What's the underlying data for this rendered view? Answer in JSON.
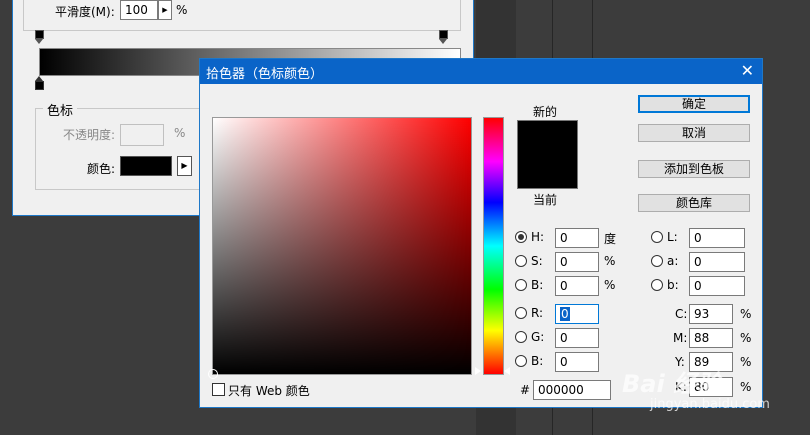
{
  "background_dialog": {
    "smoothness_label": "平滑度(M):",
    "smoothness_value": "100",
    "smoothness_unit": "%",
    "group_title": "色标",
    "opacity_label": "不透明度:",
    "opacity_unit": "%",
    "color_label": "颜色:"
  },
  "picker": {
    "title": "拾色器（色标颜色）",
    "new_label": "新的",
    "current_label": "当前",
    "buttons": {
      "ok": "确定",
      "cancel": "取消",
      "add_swatch": "添加到色板",
      "libraries": "颜色库"
    },
    "hsb": [
      {
        "label": "H:",
        "value": "0",
        "unit": "度",
        "selected": true
      },
      {
        "label": "S:",
        "value": "0",
        "unit": "%"
      },
      {
        "label": "B:",
        "value": "0",
        "unit": "%"
      }
    ],
    "rgb": [
      {
        "label": "R:",
        "value": "0"
      },
      {
        "label": "G:",
        "value": "0"
      },
      {
        "label": "B:",
        "value": "0"
      }
    ],
    "lab": [
      {
        "label": "L:",
        "value": "0"
      },
      {
        "label": "a:",
        "value": "0"
      },
      {
        "label": "b:",
        "value": "0"
      }
    ],
    "cmyk": [
      {
        "label": "C:",
        "value": "93",
        "unit": "%"
      },
      {
        "label": "M:",
        "value": "88",
        "unit": "%"
      },
      {
        "label": "Y:",
        "value": "89",
        "unit": "%"
      },
      {
        "label": "K:",
        "value": "80",
        "unit": "%"
      }
    ],
    "hex_label": "#",
    "hex_value": "000000",
    "web_only_label": "只有 Web 颜色"
  },
  "watermark": {
    "logo": "Bai 经验",
    "url": "jingyan.baidu.com"
  },
  "colors": {
    "title_bar": "#0a64c8",
    "selected_color": "#000000"
  }
}
